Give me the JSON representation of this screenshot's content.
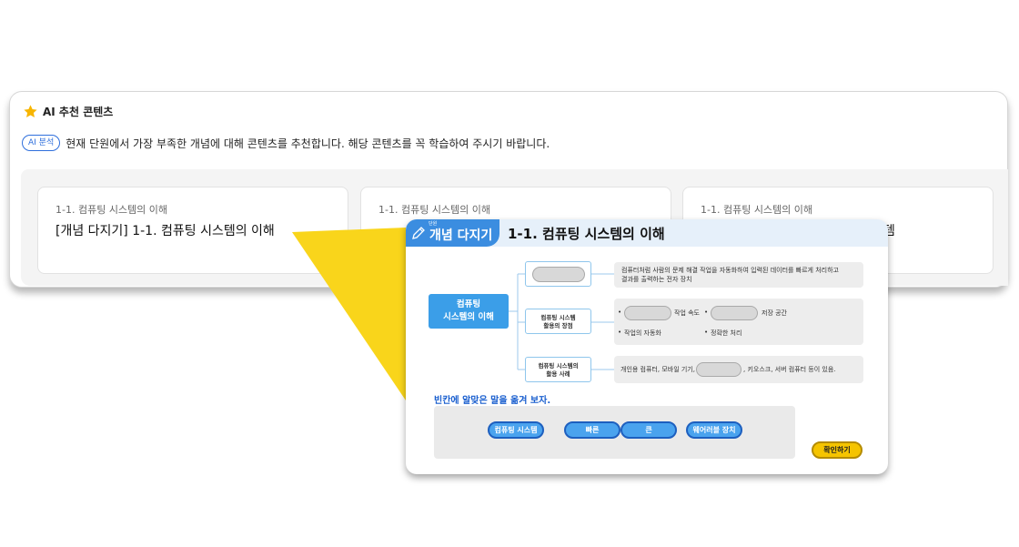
{
  "panel": {
    "title": "AI 추천 콘텐츠",
    "badge": "AI 분석",
    "description": "현재 단원에서 가장 부족한 개념에 대해 콘텐츠를 추천합니다. 해당 콘텐츠를 꼭 학습하여 주시기 바랍니다.",
    "cards": [
      {
        "subtitle": "1-1. 컴퓨팅 시스템의 이해",
        "title": "[개념 다지기] 1-1. 컴퓨팅 시스템의 이해"
      },
      {
        "subtitle": "1-1. 컴퓨팅 시스템의 이해",
        "title": ""
      },
      {
        "subtitle": "1-1. 컴퓨팅 시스템의 이해",
        "title": "템"
      }
    ]
  },
  "popup": {
    "tag_small": "단원",
    "tag_label": "개념 다지기",
    "title": "1-1. 컴퓨팅 시스템의 이해",
    "root_line1": "컴퓨팅",
    "root_line2": "시스템의 이해",
    "node2_line1": "컴퓨팅 시스템",
    "node2_line2": "활용의 장점",
    "node3_line1": "컴퓨팅 시스템의",
    "node3_line2": "활용 사례",
    "info1_line1": "컴퓨터처럼 사람의 문제 해결 작업을 자동화하여 입력된 데이터를 빠르게 처리하고",
    "info1_line2": "결과를 출력하는 전자 장치",
    "info2_speed": "작업 속도",
    "info2_storage": "저장 공간",
    "info2_auto": "작업의 자동화",
    "info2_accuracy": "정확한 처리",
    "info3_before": "개인용 컴퓨터, 모바일 기기,",
    "info3_after": ", 키오스크, 서버 컴퓨터 등이 있음.",
    "hint": "빈칸에 알맞은 말을 옮겨 보자.",
    "choices": [
      "컴퓨팅 시스템",
      "빠른",
      "큰",
      "웨어러블 장치"
    ],
    "confirm": "확인하기"
  },
  "colors": {
    "accent_blue": "#3b9ee8",
    "wedge_yellow": "#f9d51b",
    "confirm_yellow": "#f5c400"
  },
  "icons": {
    "title_icon": "star-icon",
    "tag_icon": "pencil-icon"
  }
}
